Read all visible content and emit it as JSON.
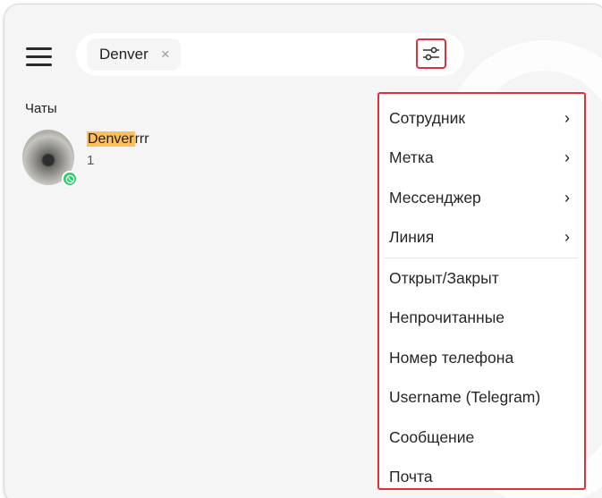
{
  "search": {
    "chip_label": "Denver",
    "chip_close": "×"
  },
  "chats": {
    "section_title": "Чаты",
    "items": [
      {
        "name_highlight": "Denver",
        "name_rest": "rrr",
        "subtitle": "1",
        "messenger": "WhatsApp"
      }
    ]
  },
  "filter_menu": {
    "submenu_items": [
      {
        "label": "Сотрудник",
        "chevron": "›"
      },
      {
        "label": "Метка",
        "chevron": "›"
      },
      {
        "label": "Мессенджер",
        "chevron": "›"
      },
      {
        "label": "Линия",
        "chevron": "›"
      }
    ],
    "items": [
      {
        "label": "Открыт/Закрыт"
      },
      {
        "label": "Непрочитанные"
      },
      {
        "label": "Номер телефона"
      },
      {
        "label": "Username (Telegram)"
      },
      {
        "label": "Сообщение"
      },
      {
        "label": "Почта"
      }
    ]
  },
  "colors": {
    "highlight": "#ffbe5c",
    "annotation_red": "#e0303a",
    "whatsapp_green": "#25d366"
  },
  "icons": {
    "menu": "hamburger-icon",
    "filter": "sliders-icon",
    "close": "close-icon",
    "chevron": "chevron-right-icon",
    "messenger": "whatsapp-icon"
  }
}
